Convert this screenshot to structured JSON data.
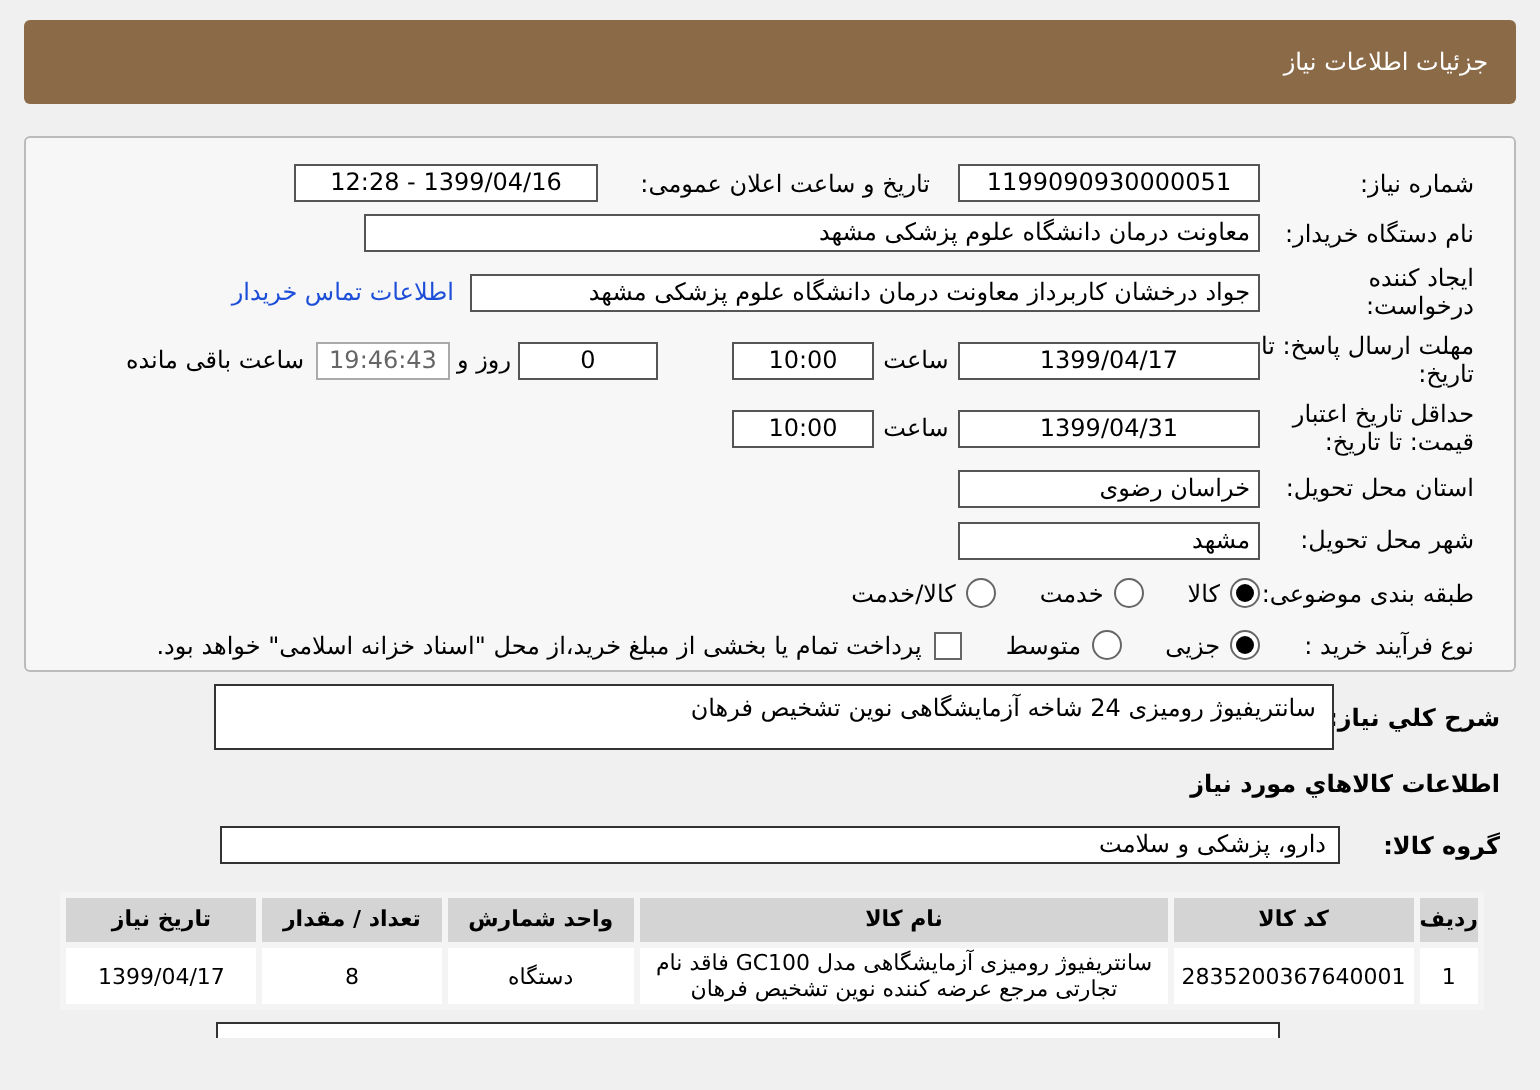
{
  "title": "جزئیات اطلاعات نیاز",
  "need_number": {
    "label": "شماره نیاز:",
    "value": "1199090930000051"
  },
  "announce": {
    "label": "تاریخ و ساعت اعلان عمومی:",
    "value": "1399/04/16 - 12:28"
  },
  "buyer": {
    "label": "نام دستگاه خریدار:",
    "value": "معاونت درمان دانشگاه علوم پزشکی مشهد"
  },
  "creator": {
    "label": "ایجاد کننده درخواست:",
    "value": "جواد درخشان کاربرداز معاونت درمان دانشگاه علوم پزشکی مشهد",
    "link": "اطلاعات تماس خریدار"
  },
  "response_deadline": {
    "label": "مهلت ارسال پاسخ: تا تاریخ:",
    "date": "1399/04/17",
    "time_label": "ساعت",
    "time": "10:00",
    "days": "0",
    "days_label": "روز و",
    "remaining": "19:46:43",
    "remaining_label": "ساعت باقی مانده"
  },
  "price_validity": {
    "label": "حداقل تاریخ اعتبار قیمت: تا تاریخ:",
    "date": "1399/04/31",
    "time_label": "ساعت",
    "time": "10:00"
  },
  "province": {
    "label": "استان محل تحویل:",
    "value": "خراسان رضوی"
  },
  "city": {
    "label": "شهر محل تحویل:",
    "value": "مشهد"
  },
  "category": {
    "label": "طبقه بندی موضوعی:",
    "options": [
      {
        "label": "کالا",
        "selected": true
      },
      {
        "label": "خدمت",
        "selected": false
      },
      {
        "label": "کالا/خدمت",
        "selected": false
      }
    ]
  },
  "purchase_type": {
    "label": "نوع فرآیند خرید :",
    "options": [
      {
        "label": "جزیی",
        "selected": true
      },
      {
        "label": "متوسط",
        "selected": false
      }
    ],
    "treasury": {
      "checked": false,
      "text": "پرداخت تمام یا بخشی از مبلغ خرید،از محل \"اسناد خزانه اسلامی\" خواهد بود."
    }
  },
  "description": {
    "label": "شرح کلي نیاز:",
    "value": "سانتریفیوژ رومیزی 24 شاخه آزمایشگاهی نوین تشخیص فرهان"
  },
  "goods_heading": "اطلاعات کالاهاي مورد نیاز",
  "goods_group": {
    "label": "گروه کالا:",
    "value": "دارو، پزشکی و سلامت"
  },
  "table": {
    "columns": [
      "ردیف",
      "کد کالا",
      "نام کالا",
      "واحد شمارش",
      "تعداد / مقدار",
      "تاریخ نیاز"
    ],
    "rows": [
      [
        "1",
        "2835200367640001",
        "سانتریفیوژ رومیزی آزمایشگاهی مدل GC100 فاقد نام تجارتی مرجع عرضه کننده نوین تشخیص فرهان",
        "دستگاه",
        "8",
        "1399/04/17"
      ]
    ]
  }
}
